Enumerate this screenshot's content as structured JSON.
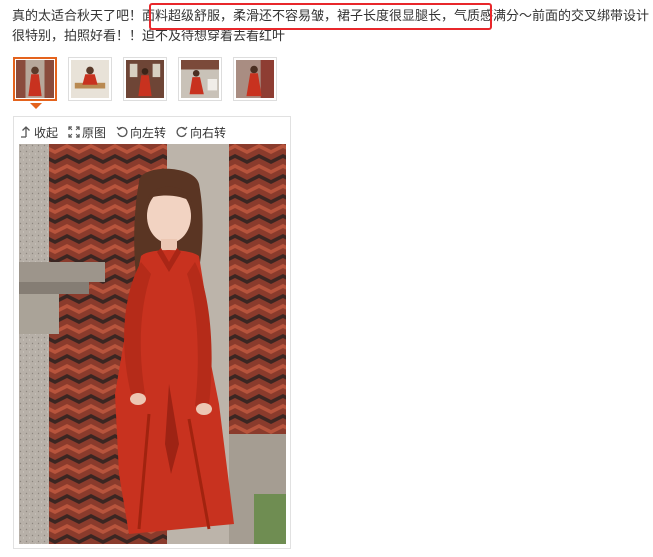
{
  "review": {
    "text": "真的太适合秋天了吧！面料超级舒服，柔滑还不容易皱，裙子长度很显腿长，气质感满分～前面的交叉绑带设计很特别，拍照好看！！迫不及待想穿着去看红叶"
  },
  "thumbnails": [
    {
      "label": "photo-1",
      "selected": true
    },
    {
      "label": "photo-2",
      "selected": false
    },
    {
      "label": "photo-3",
      "selected": false
    },
    {
      "label": "photo-4",
      "selected": false
    },
    {
      "label": "photo-5",
      "selected": false
    }
  ],
  "toolbar": {
    "collapse_label": "收起",
    "original_label": "原图",
    "rotate_left_label": "向左转",
    "rotate_right_label": "向右转"
  },
  "colors": {
    "highlight": "#e8272b",
    "selected_thumb": "#e4631d",
    "dress": "#c8321f"
  },
  "icons": {
    "collapse": "arrow-up-icon",
    "original": "expand-icon",
    "rotate_left": "rotate-left-icon",
    "rotate_right": "rotate-right-icon"
  }
}
